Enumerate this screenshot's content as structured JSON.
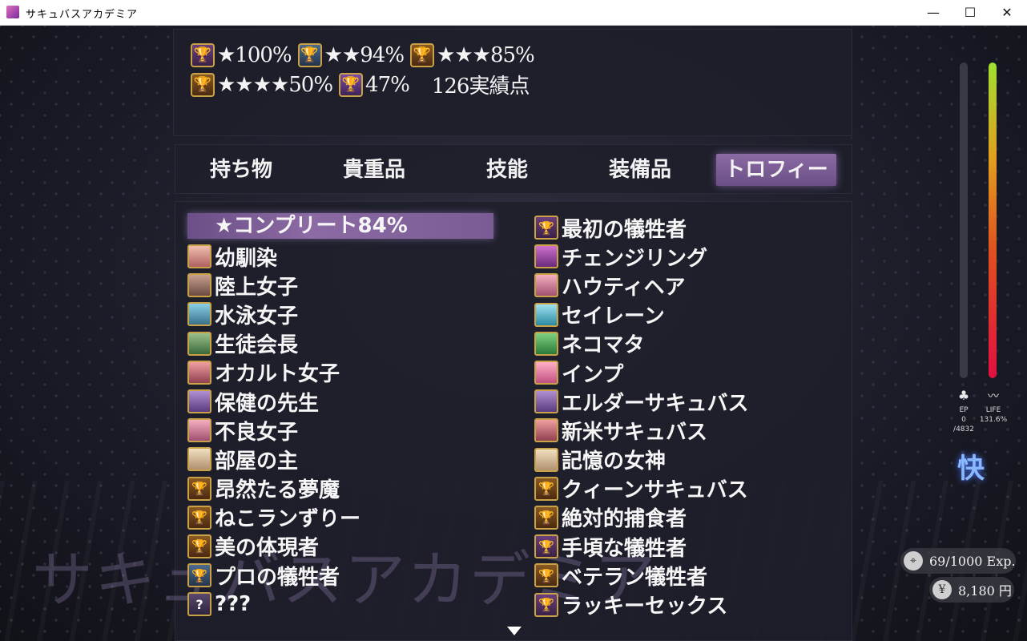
{
  "window": {
    "title": "サキュバスアカデミア",
    "min": "—",
    "max": "☐",
    "close": "✕"
  },
  "trophy_summary": {
    "rows": [
      [
        {
          "icon": "trophy-purple",
          "text": "★100%"
        },
        {
          "icon": "trophy-blue",
          "text": "★★94%"
        },
        {
          "icon": "trophy-gold",
          "text": "★★★85%"
        }
      ],
      [
        {
          "icon": "trophy-gold",
          "text": "★★★★50%"
        },
        {
          "icon": "trophy-violet",
          "text": "47%"
        },
        {
          "icon": "none",
          "text": "126実績点"
        }
      ]
    ]
  },
  "tabs": [
    {
      "label": "持ち物"
    },
    {
      "label": "貴重品"
    },
    {
      "label": "技能"
    },
    {
      "label": "装備品"
    },
    {
      "label": "トロフィー",
      "active": true
    }
  ],
  "list_left": {
    "header": "★コンプリート84%",
    "items": [
      {
        "label": "幼馴染",
        "icon": "portrait-icon"
      },
      {
        "label": "陸上女子",
        "icon": "portrait-icon"
      },
      {
        "label": "水泳女子",
        "icon": "portrait-icon"
      },
      {
        "label": "生徒会長",
        "icon": "portrait-icon"
      },
      {
        "label": "オカルト女子",
        "icon": "portrait-icon"
      },
      {
        "label": "保健の先生",
        "icon": "portrait-icon"
      },
      {
        "label": "不良女子",
        "icon": "portrait-icon"
      },
      {
        "label": "部屋の主",
        "icon": "portrait-icon"
      },
      {
        "label": "昂然たる夢魔",
        "icon": "trophy-gold-icon"
      },
      {
        "label": "ねこランずりー",
        "icon": "trophy-gold-icon"
      },
      {
        "label": "美の体現者",
        "icon": "trophy-gold-icon"
      },
      {
        "label": "プロの犠牲者",
        "icon": "trophy-blue-icon"
      },
      {
        "label": "???",
        "icon": "unknown-icon"
      }
    ]
  },
  "list_right": {
    "items": [
      {
        "label": "最初の犠牲者",
        "icon": "trophy-purple-icon"
      },
      {
        "label": "チェンジリング",
        "icon": "portrait-icon"
      },
      {
        "label": "ハウティヘア",
        "icon": "portrait-icon"
      },
      {
        "label": "セイレーン",
        "icon": "portrait-icon"
      },
      {
        "label": "ネコマタ",
        "icon": "portrait-icon"
      },
      {
        "label": "インプ",
        "icon": "portrait-icon"
      },
      {
        "label": "エルダーサキュバス",
        "icon": "portrait-icon"
      },
      {
        "label": "新米サキュバス",
        "icon": "portrait-icon"
      },
      {
        "label": "記憶の女神",
        "icon": "portrait-icon"
      },
      {
        "label": "クィーンサキュバス",
        "icon": "trophy-gold-icon"
      },
      {
        "label": "絶対的捕食者",
        "icon": "trophy-gold-icon"
      },
      {
        "label": "手頃な犠牲者",
        "icon": "trophy-purple-icon"
      },
      {
        "label": "ベテラン犠牲者",
        "icon": "trophy-gold-icon"
      },
      {
        "label": "ラッキーセックス",
        "icon": "trophy-purple-icon"
      }
    ]
  },
  "hud": {
    "ep_label": "EP",
    "ep_value": "0",
    "ep_max": "/4832",
    "ep_fraction": 0.0,
    "life_label": "LIFE",
    "life_value": "131.6%",
    "life_fraction": 1.0,
    "mood_text": "快",
    "exp": "69/1000 Exp.",
    "money": "8,180 円",
    "money_symbol": "¥"
  },
  "watermark": "サキュバスアカデミア"
}
